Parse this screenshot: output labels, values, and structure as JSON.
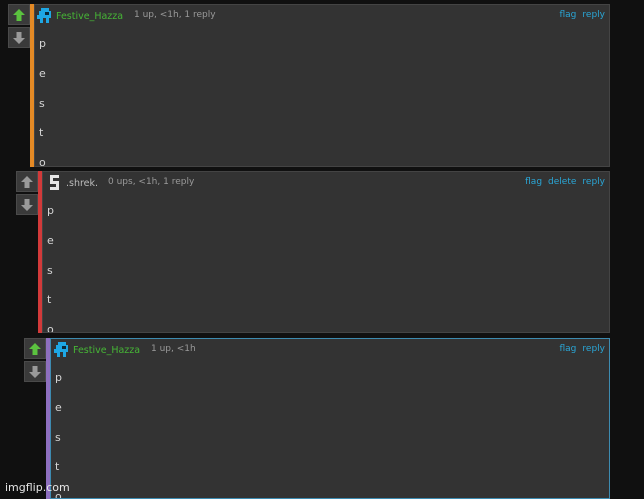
{
  "comments": [
    {
      "username": "Festive_Hazza",
      "meta": "1 up, <1h, 1 reply",
      "actions": [
        "flag",
        "reply"
      ],
      "lines": [
        "p",
        "e",
        "s",
        "t",
        "o"
      ],
      "upvoted": true,
      "bar_color": "#e48a25",
      "avatar_color": "#1ea7e4"
    },
    {
      "username": ".shrek.",
      "meta": "0 ups, <1h, 1 reply",
      "actions": [
        "flag",
        "delete",
        "reply"
      ],
      "lines": [
        "p",
        "e",
        "s",
        "t",
        "o"
      ],
      "upvoted": false,
      "bar_color": "#d23a3a",
      "avatar_color": "#e6e6e6"
    },
    {
      "username": "Festive_Hazza",
      "meta": "1 up, <1h",
      "actions": [
        "flag",
        "reply"
      ],
      "lines": [
        "p",
        "e",
        "s",
        "t",
        "o"
      ],
      "upvoted": true,
      "bar_color": "#8e6fbf",
      "avatar_color": "#1ea7e4"
    }
  ],
  "icons": {
    "upvote": "arrow-up-icon",
    "downvote": "arrow-down-icon"
  },
  "colors": {
    "upvote_active": "#5bc23f",
    "vote_inactive": "#9a9a9a",
    "link": "#2aa6d6",
    "highlight_border": "#3d8bb0"
  },
  "watermark": "imgflip.com"
}
